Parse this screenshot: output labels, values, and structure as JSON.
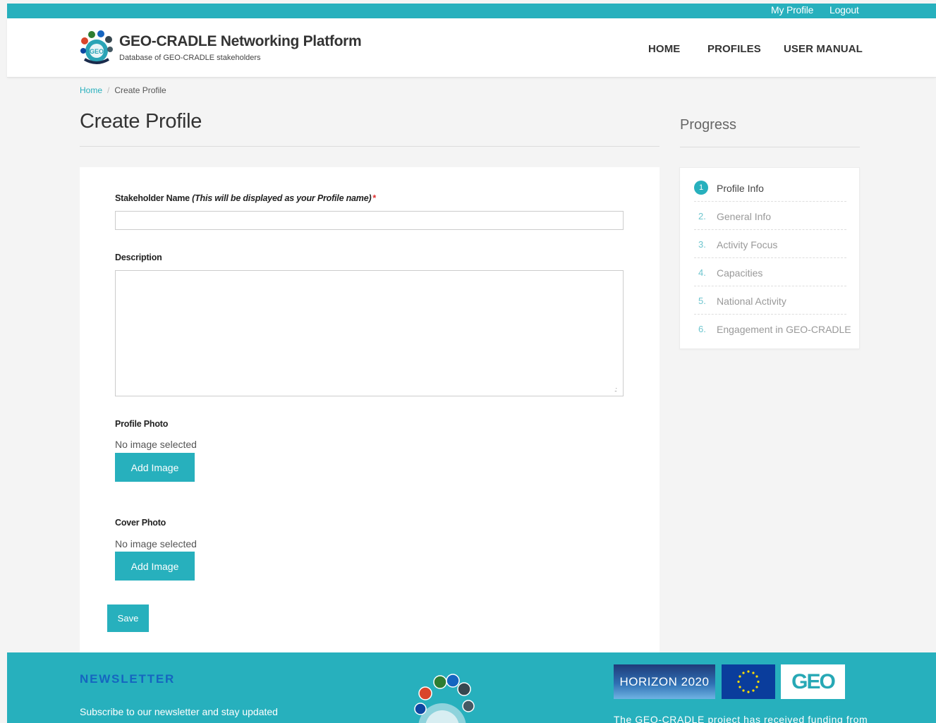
{
  "topbar": {
    "my_profile": "My Profile",
    "logout": "Logout"
  },
  "brand": {
    "title": "GEO-CRADLE Networking Platform",
    "subtitle": "Database of GEO-CRADLE stakeholders",
    "logo_icon": "geo-cradle-logo"
  },
  "nav": {
    "home": "HOME",
    "profiles": "PROFILES",
    "user_manual": "USER MANUAL"
  },
  "breadcrumb": {
    "home": "Home",
    "separator": "/",
    "current": "Create Profile"
  },
  "page": {
    "title": "Create Profile"
  },
  "form": {
    "stakeholder_name": {
      "label": "Stakeholder Name",
      "hint": "(This will be displayed as your Profile name)",
      "required_marker": "*",
      "value": ""
    },
    "description": {
      "label": "Description",
      "value": ""
    },
    "profile_photo": {
      "label": "Profile Photo",
      "status": "No image selected",
      "button": "Add Image"
    },
    "cover_photo": {
      "label": "Cover Photo",
      "status": "No image selected",
      "button": "Add Image"
    },
    "save_label": "Save"
  },
  "progress": {
    "title": "Progress",
    "steps": [
      {
        "num": "1",
        "label": "Profile Info",
        "active": true
      },
      {
        "num": "2.",
        "label": "General Info",
        "active": false
      },
      {
        "num": "3.",
        "label": "Activity Focus",
        "active": false
      },
      {
        "num": "4.",
        "label": "Capacities",
        "active": false
      },
      {
        "num": "5.",
        "label": "National Activity",
        "active": false
      },
      {
        "num": "6.",
        "label": "Engagement in GEO-CRADLE",
        "active": false
      }
    ]
  },
  "footer": {
    "newsletter_title": "NEWSLETTER",
    "newsletter_text": "Subscribe to our newsletter and stay updated",
    "horizon_label": "HORIZON 2020",
    "geo_label": "GEO",
    "funding_text": "The GEO-CRADLE project has received funding from"
  },
  "colors": {
    "accent": "#27b0bd",
    "newsletter_title": "#1565c0",
    "required": "#e03030"
  }
}
